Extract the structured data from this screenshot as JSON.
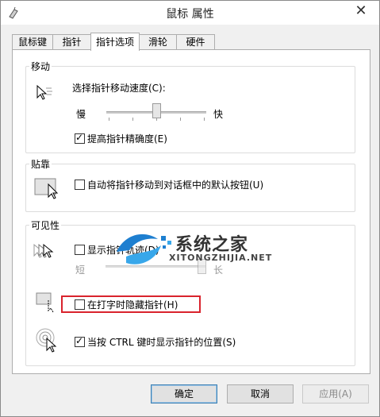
{
  "window": {
    "title": "鼠标 属性",
    "close": "✕"
  },
  "tabs": [
    {
      "label": "鼠标键"
    },
    {
      "label": "指针"
    },
    {
      "label": "指针选项"
    },
    {
      "label": "滑轮"
    },
    {
      "label": "硬件"
    }
  ],
  "active_tab": "指针选项",
  "motion": {
    "group_label": "移动",
    "speed_label": "选择指针移动速度(C):",
    "slow_label": "慢",
    "fast_label": "快",
    "speed_level": 0.5,
    "precision_label": "提高指针精确度(E)",
    "precision_checked": true
  },
  "snap": {
    "group_label": "贴靠",
    "snap_label": "自动将指针移动到对话框中的默认按钮(U)",
    "snap_checked": false
  },
  "visibility": {
    "group_label": "可见性",
    "trails_label": "显示指针轨迹(D)",
    "trails_checked": false,
    "short_label": "短",
    "long_label": "长",
    "trail_level": 1.0,
    "hide_typing_label": "在打字时隐藏指针(H)",
    "hide_typing_checked": false,
    "ctrl_label": "当按 CTRL 键时显示指针的位置(S)",
    "ctrl_checked": true
  },
  "buttons": {
    "ok": "确定",
    "cancel": "取消",
    "apply": "应用(A)"
  },
  "watermark": {
    "text": "系统之家",
    "sub": "XITONGZHIJIA.NET"
  },
  "colors": {
    "highlight": "#d9232d",
    "accent": "#3c7fb1"
  }
}
